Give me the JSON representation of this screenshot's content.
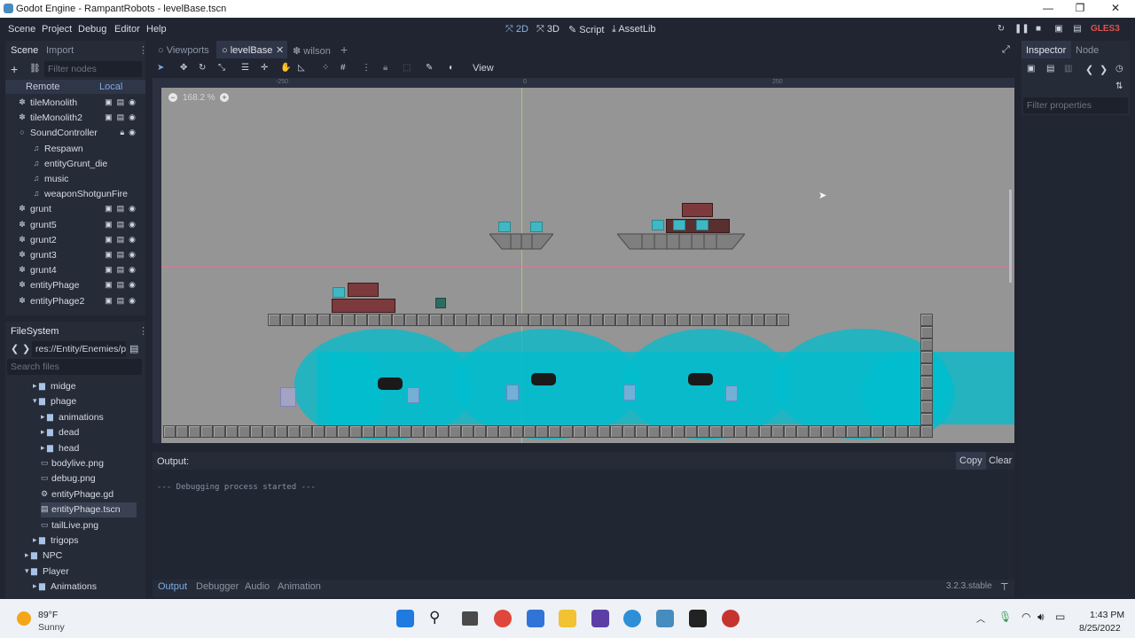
{
  "window": {
    "title": "Godot Engine - RampantRobots - levelBase.tscn"
  },
  "menu": {
    "items": [
      "Scene",
      "Project",
      "Debug",
      "Editor",
      "Help"
    ]
  },
  "workspaces": [
    {
      "label": "2D",
      "active": true
    },
    {
      "label": "3D",
      "active": false
    },
    {
      "label": "Script",
      "active": false
    },
    {
      "label": "AssetLib",
      "active": false
    }
  ],
  "renderer": "GLES3",
  "scene_panel": {
    "tabs": [
      "Scene",
      "Import"
    ],
    "filter_placeholder": "Filter nodes",
    "remote_label": "Remote",
    "local_label": "Local",
    "nodes": [
      {
        "name": "tileMonolith",
        "icon": "sprite-icon",
        "indent": 1
      },
      {
        "name": "tileMonolith2",
        "icon": "sprite-icon",
        "indent": 1
      },
      {
        "name": "SoundController",
        "icon": "node-icon",
        "indent": 1
      },
      {
        "name": "Respawn",
        "icon": "audio-icon",
        "indent": 2
      },
      {
        "name": "entityGrunt_die",
        "icon": "audio-icon",
        "indent": 2
      },
      {
        "name": "music",
        "icon": "audio-icon",
        "indent": 2
      },
      {
        "name": "weaponShotgunFire",
        "icon": "audio-icon",
        "indent": 2
      },
      {
        "name": "grunt",
        "icon": "sprite-icon",
        "indent": 1
      },
      {
        "name": "grunt5",
        "icon": "sprite-icon",
        "indent": 1
      },
      {
        "name": "grunt2",
        "icon": "sprite-icon",
        "indent": 1
      },
      {
        "name": "grunt3",
        "icon": "sprite-icon",
        "indent": 1
      },
      {
        "name": "grunt4",
        "icon": "sprite-icon",
        "indent": 1
      },
      {
        "name": "entityPhage",
        "icon": "sprite-icon",
        "indent": 1
      },
      {
        "name": "entityPhage2",
        "icon": "sprite-icon",
        "indent": 1
      }
    ]
  },
  "filesystem": {
    "title": "FileSystem",
    "path": "res://Entity/Enemies/p",
    "search_placeholder": "Search files",
    "items": [
      {
        "name": "midge",
        "type": "folder",
        "indent": 3
      },
      {
        "name": "phage",
        "type": "folder-open",
        "indent": 3
      },
      {
        "name": "animations",
        "type": "folder",
        "indent": 4
      },
      {
        "name": "dead",
        "type": "folder",
        "indent": 4
      },
      {
        "name": "head",
        "type": "folder",
        "indent": 4
      },
      {
        "name": "bodylive.png",
        "type": "image",
        "indent": 4
      },
      {
        "name": "debug.png",
        "type": "image",
        "indent": 4
      },
      {
        "name": "entityPhage.gd",
        "type": "script",
        "indent": 4
      },
      {
        "name": "entityPhage.tscn",
        "type": "scene",
        "indent": 4,
        "selected": true
      },
      {
        "name": "tailLive.png",
        "type": "image",
        "indent": 4
      },
      {
        "name": "trigops",
        "type": "folder",
        "indent": 3
      },
      {
        "name": "NPC",
        "type": "folder",
        "indent": 2
      },
      {
        "name": "Player",
        "type": "folder-open",
        "indent": 2
      },
      {
        "name": "Animations",
        "type": "folder",
        "indent": 3
      }
    ]
  },
  "editor_tabs": [
    {
      "label": "Viewports",
      "active": false
    },
    {
      "label": "levelBase",
      "active": true
    },
    {
      "label": "wilson",
      "active": false
    }
  ],
  "toolbar": {
    "view_label": "View"
  },
  "viewport": {
    "zoom": "168.2 %",
    "ruler_labels": [
      "-250",
      "0",
      "250"
    ]
  },
  "inspector": {
    "tabs": [
      "Inspector",
      "Node"
    ],
    "filter_placeholder": "Filter properties"
  },
  "output": {
    "title": "Output:",
    "copy_label": "Copy",
    "clear_label": "Clear",
    "log": "--- Debugging process started ---",
    "bottom_tabs": [
      "Output",
      "Debugger",
      "Audio",
      "Animation"
    ],
    "version": "3.2.3.stable"
  },
  "taskbar": {
    "temperature": "89°F",
    "weather": "Sunny",
    "time": "1:43 PM",
    "date": "8/25/2022"
  },
  "colors": {
    "accent": "#478cbf",
    "viewport_bg": "#959595",
    "water": "#00bccd",
    "editor_bg": "#202531"
  }
}
